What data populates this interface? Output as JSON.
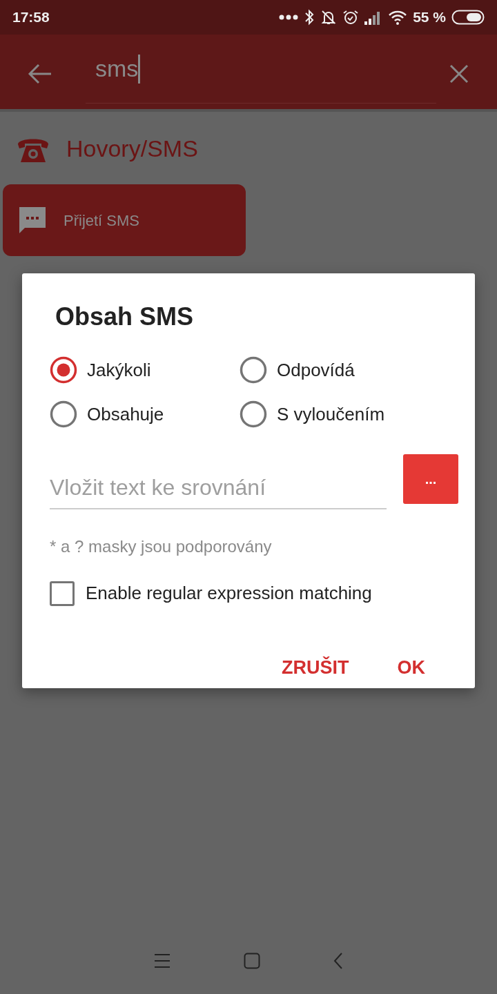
{
  "status_bar": {
    "time": "17:58",
    "battery": "55 %"
  },
  "search_bar": {
    "value": "sms"
  },
  "category": {
    "title": "Hovory/SMS"
  },
  "items": [
    {
      "label": "Přijetí SMS"
    }
  ],
  "dialog": {
    "title": "Obsah SMS",
    "options": [
      {
        "label": "Jakýkoli",
        "selected": true
      },
      {
        "label": "Odpovídá",
        "selected": false
      },
      {
        "label": "Obsahuje",
        "selected": false
      },
      {
        "label": "S vyloučením",
        "selected": false
      }
    ],
    "text_field": {
      "placeholder": "Vložit text ke srovnání"
    },
    "picker_button": "...",
    "hint": "* a ? masky jsou podporovány",
    "regex_checkbox": {
      "label": "Enable regular expression matching",
      "checked": false
    },
    "buttons": [
      "ZRUŠIT",
      "OK"
    ]
  }
}
